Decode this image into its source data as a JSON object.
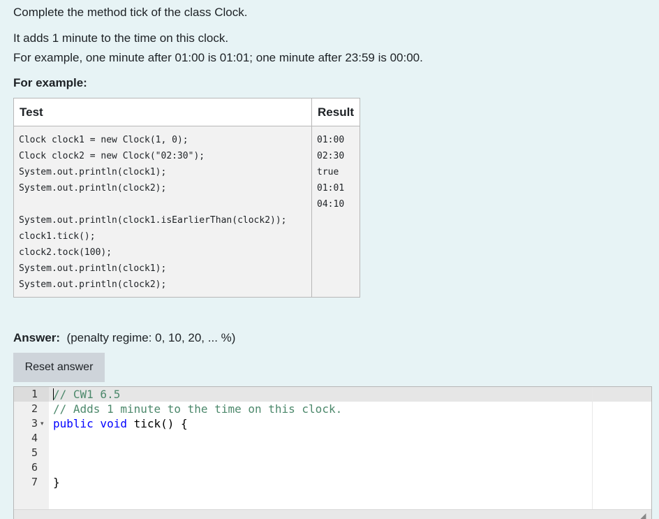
{
  "question": {
    "line1": "Complete the method tick of the class Clock.",
    "line2": "It adds 1 minute to the time on this clock.",
    "line3": "For example, one minute after 01:00 is 01:01; one minute after 23:59 is 00:00.",
    "examples_heading": "For example:"
  },
  "examples_table": {
    "headers": [
      "Test",
      "Result"
    ],
    "test_code": "Clock clock1 = new Clock(1, 0);\nClock clock2 = new Clock(\"02:30\");\nSystem.out.println(clock1);\nSystem.out.println(clock2);\n\nSystem.out.println(clock1.isEarlierThan(clock2));\nclock1.tick();\nclock2.tock(100);\nSystem.out.println(clock1);\nSystem.out.println(clock2);",
    "result": "01:00\n02:30\ntrue\n01:01\n04:10"
  },
  "answer": {
    "label": "Answer:",
    "penalty": "(penalty regime: 0, 10, 20, ... %)",
    "reset_label": "Reset answer"
  },
  "editor": {
    "line_numbers": [
      "1",
      "2",
      "3",
      "4",
      "5",
      "6",
      "7"
    ],
    "lines": {
      "l1": "// CW1 6.5",
      "l2": "// Adds 1 minute to the time on this clock.",
      "l3_kw": "public void",
      "l3_rest": " tick() {",
      "l7": "}"
    },
    "fold_marker": "▾",
    "resize_icon": "◢"
  }
}
